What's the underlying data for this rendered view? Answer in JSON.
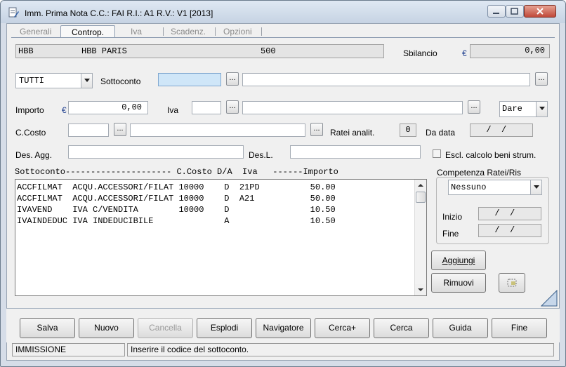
{
  "window": {
    "title": "Imm. Prima Nota C.C.: FAI  R.I.: A1  R.V.: V1  [2013]"
  },
  "tabs": [
    {
      "label": "Generali",
      "active": false
    },
    {
      "label": "Controp.",
      "active": true
    },
    {
      "label": "Iva",
      "active": false
    },
    {
      "label": "Scadenz.",
      "active": false
    },
    {
      "label": "Opzioni",
      "active": false
    }
  ],
  "header": {
    "code": "HBB",
    "name": "HBB PARIS",
    "number": "500",
    "sbilancio_label": "Sbilancio",
    "currency": "€",
    "sbilancio_value": "0,00"
  },
  "form": {
    "filter_value": "TUTTI",
    "sottoconto_label": "Sottoconto",
    "sottoconto_value": "",
    "sottoconto_desc": "",
    "importo_label": "Importo",
    "currency": "€",
    "importo_value": "0,00",
    "iva_label": "Iva",
    "iva_value": "",
    "iva_desc": "",
    "dare_avere_value": "Dare",
    "ccosto_label": "C.Costo",
    "ccosto_value": "",
    "ccosto_desc": "",
    "ratei_label": "Ratei analit.",
    "ratei_value": "0",
    "da_data_label": "Da data",
    "da_data_value": "  /  /",
    "des_agg_label": "Des. Agg.",
    "des_agg_value": "",
    "des_l_label": "Des.L.",
    "des_l_value": "",
    "escl_label": "Escl. calcolo beni strum."
  },
  "table": {
    "header": "Sottoconto--------------------- C.Costo D/A  Iva   ------Importo",
    "rows": [
      "ACCFILMAT  ACQU.ACCESSORI/FILAT 10000    D  21PD          50.00",
      "ACCFILMAT  ACQU.ACCESSORI/FILAT 10000    D  A21           50.00",
      "IVAVEND    IVA C/VENDITA        10000    D                10.50",
      "IVAINDEDUC IVA INDEDUCIBILE              A                10.50"
    ]
  },
  "competenza": {
    "label": "Competenza Ratei/Ris",
    "select_value": "Nessuno",
    "inizio_label": "Inizio",
    "inizio_value": "  /  /",
    "fine_label": "Fine",
    "fine_value": "  /  /"
  },
  "side_buttons": {
    "aggiungi": "Aggiungi",
    "rimuovi": "Rimuovi"
  },
  "bottom_buttons": [
    {
      "name": "salva",
      "label": "Salva",
      "disabled": false
    },
    {
      "name": "nuovo",
      "label": "Nuovo",
      "disabled": false
    },
    {
      "name": "cancella",
      "label": "Cancella",
      "disabled": true
    },
    {
      "name": "esplodi",
      "label": "Esplodi",
      "disabled": false
    },
    {
      "name": "navigatore",
      "label": "Navigatore",
      "disabled": false
    },
    {
      "name": "cerca-plus",
      "label": "Cerca+",
      "disabled": false
    },
    {
      "name": "cerca",
      "label": "Cerca",
      "disabled": false
    },
    {
      "name": "guida",
      "label": "Guida",
      "disabled": false
    },
    {
      "name": "fine",
      "label": "Fine",
      "disabled": false
    }
  ],
  "status": {
    "mode": "IMMISSIONE",
    "message": "Inserire il codice del sottoconto."
  },
  "icons": {
    "app": "document-pen-icon",
    "clear": "eraser-icon",
    "resize": "resize-corner-icon",
    "accent": "#3a6ea5",
    "grid_border": "#7a7a7a"
  }
}
